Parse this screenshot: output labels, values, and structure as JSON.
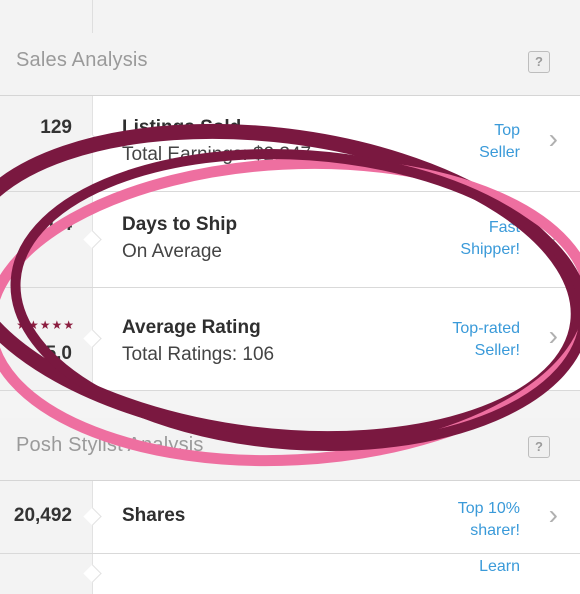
{
  "sections": {
    "sales": {
      "title": "Sales Analysis",
      "help_icon": "?"
    },
    "stylist": {
      "title": "Posh Stylist Analysis",
      "help_icon": "?"
    }
  },
  "rows": [
    {
      "value": "129",
      "title": "Listings Sold",
      "subtitle": "Total Earnings: $2,347",
      "badge_line1": "Top",
      "badge_line2": "Seller"
    },
    {
      "value": "1.4",
      "title": "Days to Ship",
      "subtitle": "On Average",
      "badge_line1": "Fast",
      "badge_line2": "Shipper!"
    },
    {
      "value": "5.0",
      "stars": "★★★★★",
      "title": "Average Rating",
      "subtitle": "Total Ratings: 106",
      "badge_line1": "Top-rated",
      "badge_line2": "Seller!"
    },
    {
      "value": "20,492",
      "title": "Shares",
      "subtitle": "",
      "badge_line1": "Top 10%",
      "badge_line2": "sharer!"
    },
    {
      "value": "",
      "title": "",
      "subtitle": "",
      "badge_line1": "Learn",
      "badge_line2": ""
    }
  ],
  "icons": {
    "chevron": "chevron-right-icon",
    "help": "question-icon",
    "stars": "star-icon"
  },
  "colors": {
    "link_blue": "#3a9ad9",
    "star_maroon": "#8b1d3f",
    "oval_maroon": "#7a1840",
    "oval_pink": "#ee6fa0"
  }
}
